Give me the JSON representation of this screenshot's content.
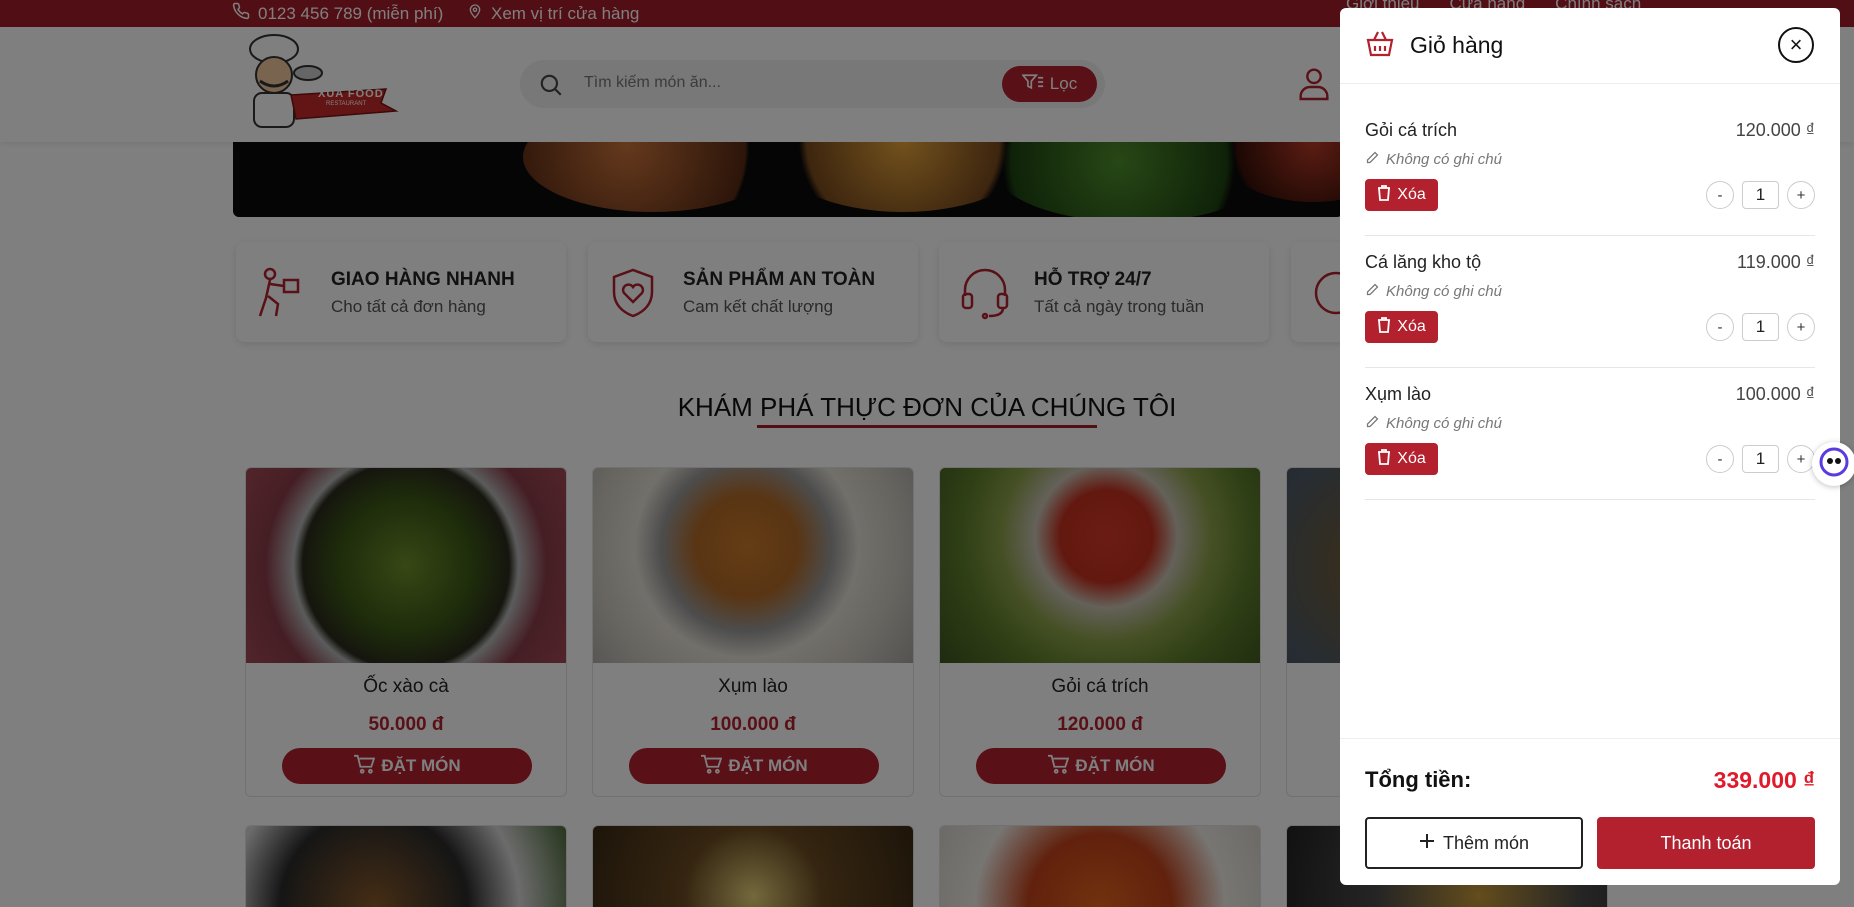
{
  "topbar": {
    "phone": "0123 456 789 (miễn phí)",
    "location": "Xem vị trí cửa hàng",
    "links": [
      "Giới thiệu",
      "Cửa hàng",
      "Chính sách"
    ]
  },
  "header": {
    "logo_text": "XUA FOOD",
    "logo_sub": "RESTAURANT",
    "search_placeholder": "Tìm kiếm món ăn...",
    "filter_label": "Lọc"
  },
  "features": [
    {
      "title": "GIAO HÀNG NHANH",
      "subtitle": "Cho tất cả đơn hàng",
      "icon": "delivery-icon"
    },
    {
      "title": "SẢN PHẨM AN TOÀN",
      "subtitle": "Cam kết chất lượng",
      "icon": "shield-heart-icon"
    },
    {
      "title": "HỖ TRỢ 24/7",
      "subtitle": "Tất cả ngày trong tuần",
      "icon": "headset-icon"
    }
  ],
  "menu_title": "KHÁM PHÁ THỰC ĐƠN CỦA CHÚNG TÔI",
  "products": [
    {
      "name": "Ốc xào cà",
      "price": "50.000 đ",
      "button": "ĐẶT MÓN"
    },
    {
      "name": "Xụm lào",
      "price": "100.000 đ",
      "button": "ĐẶT MÓN"
    },
    {
      "name": "Gỏi cá trích",
      "price": "120.000 đ",
      "button": "ĐẶT MÓN"
    }
  ],
  "cart": {
    "title": "Giỏ hàng",
    "close_symbol": "×",
    "items": [
      {
        "name": "Gỏi cá trích",
        "price": "120.000 ₫",
        "note": "Không có ghi chú",
        "delete_label": "Xóa",
        "qty": "1",
        "minus": "-",
        "plus": "+"
      },
      {
        "name": "Cá lăng kho tộ",
        "price": "119.000 ₫",
        "note": "Không có ghi chú",
        "delete_label": "Xóa",
        "qty": "1",
        "minus": "-",
        "plus": "+"
      },
      {
        "name": "Xụm lào",
        "price": "100.000 ₫",
        "note": "Không có ghi chú",
        "delete_label": "Xóa",
        "qty": "1",
        "minus": "-",
        "plus": "+"
      }
    ],
    "total_label": "Tổng tiền:",
    "total_value": "339.000 ₫",
    "add_more_label": "Thêm món",
    "checkout_label": "Thanh toán"
  },
  "colors": {
    "brand": "#b3202e",
    "topbar": "#a51c2a",
    "total": "#e0192b"
  }
}
